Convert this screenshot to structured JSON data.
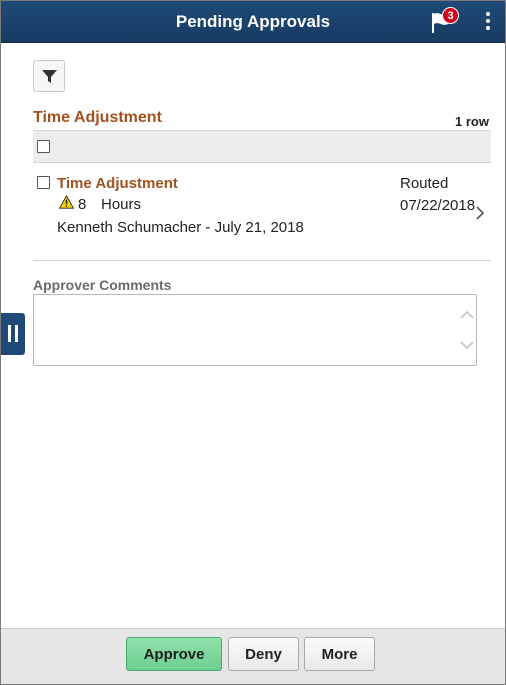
{
  "header": {
    "title": "Pending Approvals",
    "notification_count": "3"
  },
  "section": {
    "title": "Time Adjustment",
    "row_count": "1 row"
  },
  "item": {
    "title": "Time Adjustment",
    "hours_value": "8",
    "hours_unit": "Hours",
    "meta": "Kenneth Schumacher - July 21, 2018",
    "status": "Routed",
    "date": "07/22/2018"
  },
  "comments": {
    "label": "Approver Comments",
    "value": ""
  },
  "footer": {
    "approve_label": "Approve",
    "deny_label": "Deny",
    "more_label": "More"
  },
  "colors": {
    "header": "#1f4a78",
    "section_title": "#a1521f",
    "approve": "#6fcf91",
    "badge": "#d0021b"
  }
}
